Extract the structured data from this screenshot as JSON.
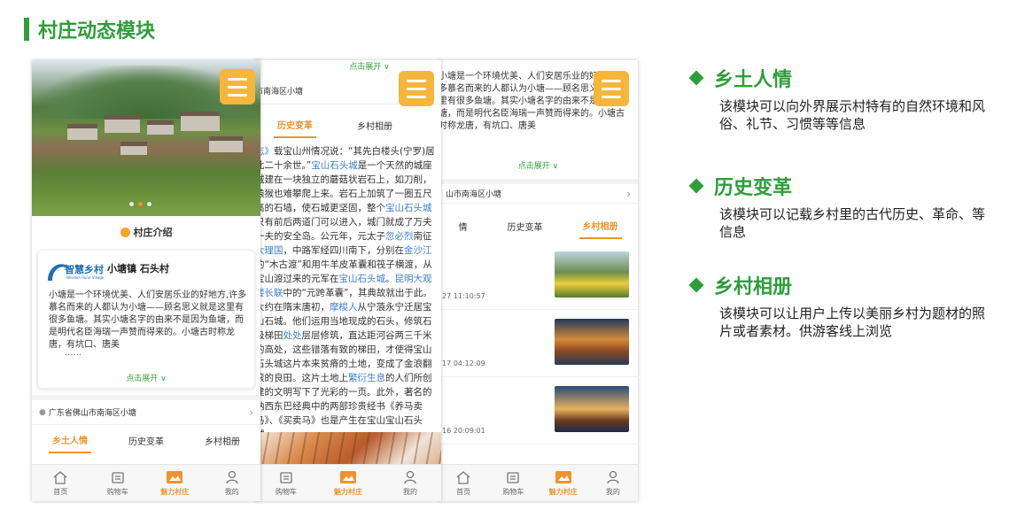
{
  "page": {
    "title": "村庄动态模块"
  },
  "features": [
    {
      "title": "乡土人情",
      "desc": "该模块可以向外界展示村特有的自然环境和风俗、礼节、习惯等等信息"
    },
    {
      "title": "历史变革",
      "desc": "该模块可以记载乡村里的古代历史、革命、等信息"
    },
    {
      "title": "乡村相册",
      "desc": "该模块可以让用户上传以美丽乡村为题材的照片或者素材。供游客线上浏览"
    }
  ],
  "colors": {
    "accent_green": "#2e9e3a",
    "accent_orange": "#f0932b",
    "menu_yellow": "#f5b63a",
    "link_blue": "#3d7fd1"
  },
  "tabbar": [
    {
      "label": "首页",
      "icon": "home-icon"
    },
    {
      "label": "购物车",
      "icon": "cart-icon"
    },
    {
      "label": "魅力村庄",
      "icon": "village-icon"
    },
    {
      "label": "我的",
      "icon": "user-icon"
    }
  ],
  "segments": [
    "乡土人情",
    "历史变革",
    "乡村相册"
  ],
  "phone1": {
    "section_title": "村庄介绍",
    "logo_text": "智慧乡村",
    "logo_sub": "Wisdom Rural Village",
    "card_title": "小塘镇 石头村",
    "card_body": "小塘是一个环境优美、人们安居乐业的好地方,许多慕名而来的人都认为小塘——顾名思义就是这里有很多鱼塘。其实小塘名字的由来不是因为鱼塘，而是明代名臣海瑞一声赞而得来的。小塘古时称龙唐，有坑口、唐美",
    "card_ellipsis": "......",
    "expand": "点击展开",
    "address": "广东省佛山市南海区小塘",
    "active_segment": "乡土人情",
    "active_tab": "魅力村庄"
  },
  "phone2": {
    "top_expand": "点击展开",
    "address": "市南海区小塘",
    "segments": [
      "历史变革",
      "乡村相册"
    ],
    "active_segment": "历史变革",
    "paragraphs": [
      [
        {
          "t": "志》",
          "hl": true
        },
        {
          "t": "载宝山州情况说：“其先白楼头(宁"
        },
        {
          "t": "罗)居此二十余世。”"
        },
        {
          "t": "宝山石头城",
          "hl": true
        },
        {
          "t": "是一个天然的城座城建在一块独立的蘑菇状岩石上，如刀削，猿猴也难攀爬上来。岩石上加筑了一圈五尺高的石墙，使石城更坚固，整个"
        },
        {
          "t": "宝山石头城",
          "hl": true
        },
        {
          "t": "只有前后两道门可以进入，城门就成了万夫一夫的安全岛。公元年，元太子"
        },
        {
          "t": "忽必烈",
          "hl": true
        },
        {
          "t": "南征"
        },
        {
          "t": "大理国",
          "hl": true
        },
        {
          "t": "，中路军经四川南下，分别在"
        },
        {
          "t": "金沙江",
          "hl": true
        },
        {
          "t": "的“木古渡”和用牛羊皮革囊和筏子横渡，从宝山渡过来的元军在"
        },
        {
          "t": "宝山石头城",
          "hl": true
        },
        {
          "t": "。"
        },
        {
          "t": "昆明大观楼长联",
          "hl": true
        },
        {
          "t": "中的“元跨革囊”，其典故就出于此。大约在隋末唐初，"
        },
        {
          "t": "摩梭人",
          "hl": true
        },
        {
          "t": "从宁蒗永宁迁居宝山石城。他们运用当地现成的石头，修筑石级梯田"
        },
        {
          "t": "处处",
          "hl": true
        },
        {
          "t": "层层修筑，直达距河谷两三千米的高处，这些错落有致的梯田，才使得宝山石头城这片本来贫瘠的土地，变成了金浪翻滚的良田。这片土地上"
        },
        {
          "t": "繁衍生息",
          "hl": true
        },
        {
          "t": "的人们所创建的文明写下了光彩的一页。此外，著名的纳西东巴经典中的两部珍贵经书《养马卖马》、《买卖马》也是产生在宝山宝山石头城。"
        }
      ]
    ],
    "active_tab": "魅力村庄"
  },
  "phone3": {
    "intro_text": "小塘是一个环境优美、人们安居乐业的好地方,许多慕名而来的人都认为小塘——顾名思义就是这里有很多鱼塘。其实小塘名字的由来不是因为鱼塘，而是明代名臣海瑞一声赞而得来的。小塘古时称龙唐，有坑口、唐美",
    "expand": "点击展开",
    "address": "山市南海区小塘",
    "segments": [
      "情",
      "历史变革",
      "乡村相册"
    ],
    "active_segment": "乡村相册",
    "photos": [
      {
        "time": "27 11:10:57"
      },
      {
        "time": "17 04:12:09"
      },
      {
        "time": "16 20:09:01"
      }
    ],
    "active_tab": "魅力村庄"
  }
}
